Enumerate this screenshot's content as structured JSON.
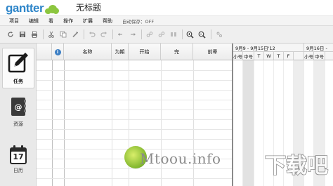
{
  "header": {
    "logo_text": "gantter",
    "document_title": "无标题"
  },
  "menu": {
    "items": [
      "项目",
      "编辑",
      "看",
      "操作",
      "扩展",
      "帮助"
    ],
    "autosave": "自动保存：OFF"
  },
  "toolbar": {
    "icons": [
      "refresh-icon",
      "save-icon",
      "print-icon",
      "cut-icon",
      "copy-icon",
      "paste-icon",
      "undo-icon",
      "redo-icon",
      "indent-icon",
      "outdent-icon",
      "move-up-icon",
      "move-down-icon",
      "link-icon",
      "unlink-icon",
      "split-icon",
      "zoom-in-icon",
      "zoom-out-icon",
      "settings-icon"
    ]
  },
  "sidebar": {
    "items": [
      {
        "label": "任务",
        "icon": "task-edit-icon",
        "active": true
      },
      {
        "label": "资源",
        "icon": "resource-contact-icon",
        "active": false
      },
      {
        "label": "日历",
        "icon": "calendar-icon",
        "active": false,
        "day": "17"
      }
    ]
  },
  "grid": {
    "info_icon": "i",
    "columns": [
      "名称",
      "为期",
      "开始",
      "完",
      "前辈"
    ]
  },
  "gantt": {
    "weeks": [
      "9月9 - 9月15日'12",
      "9月16日 -"
    ],
    "days": [
      "小号",
      "中号",
      "T",
      "W",
      "T",
      "F",
      "小号",
      "中号"
    ]
  },
  "watermark": {
    "site": "Mtoou.info",
    "brand": "下载吧"
  },
  "colors": {
    "logo_blue": "#2f86c9",
    "logo_green": "#8cc63f",
    "info_blue": "#3c7fc4"
  }
}
